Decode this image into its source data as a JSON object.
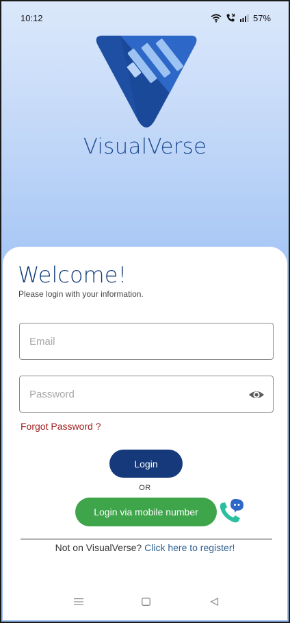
{
  "status_bar": {
    "time": "10:12",
    "battery": "57%",
    "icons": [
      "wifi-icon",
      "call-icon",
      "signal-icon"
    ]
  },
  "brand": {
    "name": "VisualVerse",
    "logo_colors": [
      "#1e4fa3",
      "#2d67c8",
      "#9dc3f2"
    ]
  },
  "login": {
    "title": "Welcome!",
    "subtitle": "Please login with your information.",
    "email_placeholder": "Email",
    "email_value": "",
    "password_placeholder": "Password",
    "password_value": "",
    "forgot_label": "Forgot Password ?",
    "login_label": "Login",
    "or_label": "OR",
    "mobile_label": "Login via mobile number",
    "register_prefix": "Not on VisualVerse? ",
    "register_link": "Click here to register!"
  },
  "colors": {
    "primary": "#15397a",
    "success": "#3ea54b",
    "danger": "#a21f1f",
    "link": "#2f5f8f"
  },
  "nav_bar": {
    "icons": [
      "menu-icon",
      "home-icon",
      "back-icon"
    ]
  }
}
